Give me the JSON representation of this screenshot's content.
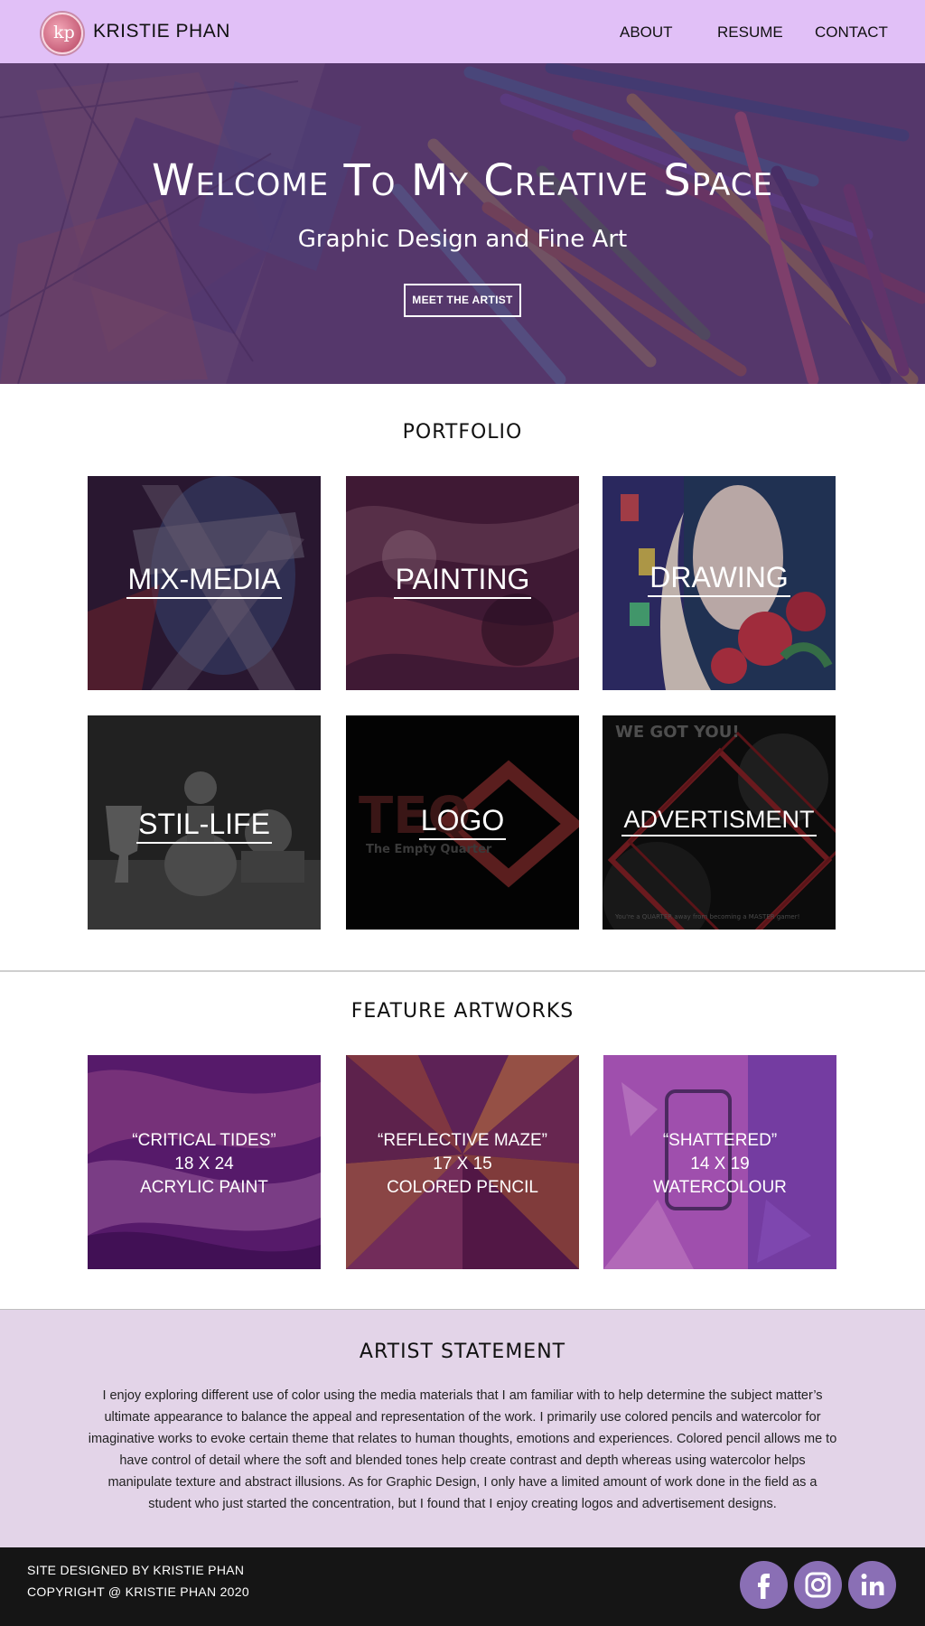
{
  "nav": {
    "logo_text": "kp",
    "brand": "KRISTIE PHAN",
    "links": [
      "ABOUT",
      "RESUME",
      "CONTACT"
    ]
  },
  "hero": {
    "title": "Welcome To My Creative Space",
    "subtitle": "Graphic Design and Fine Art",
    "button": "MEET THE ARTIST"
  },
  "portfolio": {
    "title": "PORTFOLIO",
    "tiles": [
      "MIX-MEDIA",
      "PAINTING",
      "DRAWING",
      "STIL-LIFE",
      "LOGO",
      "ADVERTISMENT"
    ],
    "logo_art_text": "TEQ",
    "logo_art_caption": "The Empty Quarter",
    "ad_art_headline": "WE GOT YOU!",
    "ad_art_tag": "You're a QUARTER away from becoming a MASTER gamer!"
  },
  "features": {
    "title": "FEATURE ARTWORKS",
    "items": [
      {
        "name": "“CRITICAL TIDES”",
        "size": "18 X 24",
        "medium": "ACRYLIC PAINT"
      },
      {
        "name": "“REFLECTIVE MAZE”",
        "size": "17 X 15",
        "medium": "COLORED PENCIL"
      },
      {
        "name": "“SHATTERED”",
        "size": "14 X 19",
        "medium": "WATERCOLOUR"
      }
    ]
  },
  "statement": {
    "title": "ARTIST STATEMENT",
    "body": "I enjoy exploring different use of color using the media materials that I am familiar with to help determine the subject matter’s ultimate appearance to balance the appeal and representation of the work. I primarily use colored pencils and watercolor for imaginative works to evoke certain theme that relates to human thoughts, emotions and experiences. Colored pencil allows me to have control of detail where the soft and blended tones help create contrast and depth whereas using watercolor helps manipulate texture and abstract illusions. As for Graphic Design, I only have a limited amount of work done in the field as a student who just started the concentration, but I found that I enjoy creating logos and advertisement designs."
  },
  "footer": {
    "designed_by": "SITE DESIGNED BY KRISTIE PHAN",
    "copyright": "COPYRIGHT @ KRISTIE PHAN 2020",
    "social": [
      "facebook-icon",
      "instagram-icon",
      "linkedin-icon"
    ]
  },
  "colors": {
    "nav_bg": "#e1c0f7",
    "statement_bg": "#e3d4e8",
    "footer_bg": "#151515",
    "social_bg": "#8a6fb5"
  }
}
